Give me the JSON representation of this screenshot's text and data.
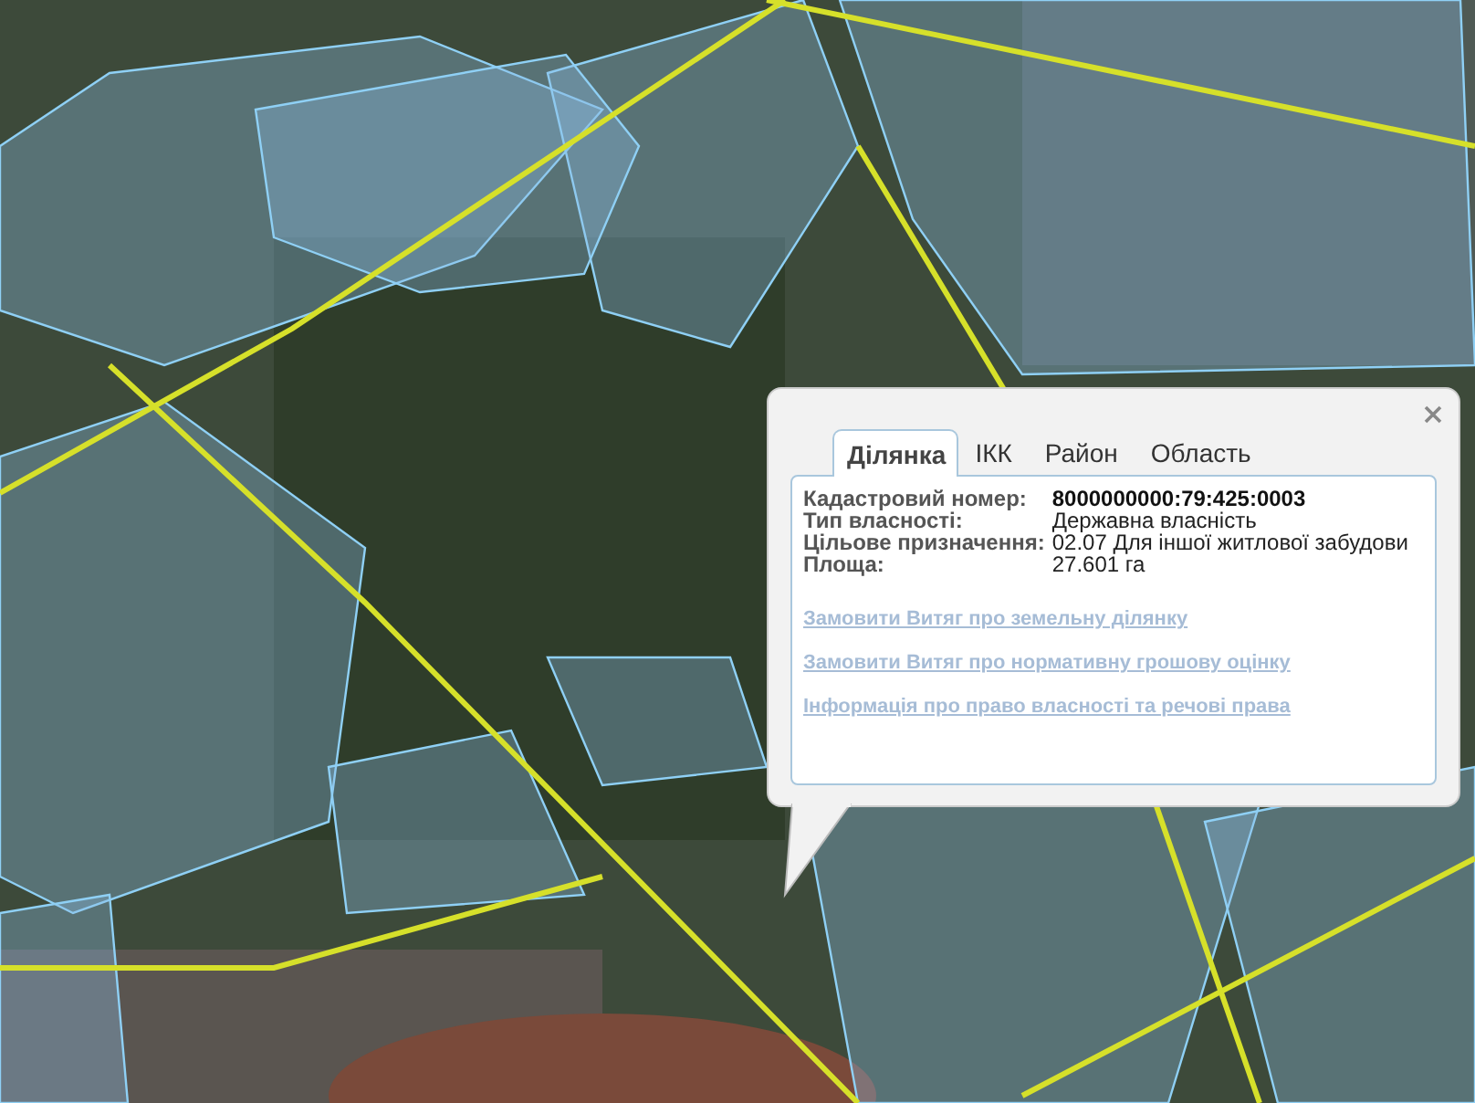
{
  "popup": {
    "tabs": [
      {
        "label": "Ділянка",
        "selected": true
      },
      {
        "label": "ІКК",
        "selected": false
      },
      {
        "label": "Район",
        "selected": false
      },
      {
        "label": "Область",
        "selected": false
      }
    ],
    "fields": [
      {
        "label": "Кадастровий номер:",
        "value": "8000000000:79:425:0003",
        "bold": true
      },
      {
        "label": "Тип власності:",
        "value": "Державна власність",
        "bold": false
      },
      {
        "label": "Цільове призначення:",
        "value": "02.07 Для іншої житлової забудови",
        "bold": false
      },
      {
        "label": "Площа:",
        "value": "27.601 га",
        "bold": false
      }
    ],
    "links": [
      "Замовити Витяг про земельну ділянку",
      "Замовити Витяг про нормативну грошову оцінку",
      "Інформація про право власності та речові права"
    ]
  }
}
